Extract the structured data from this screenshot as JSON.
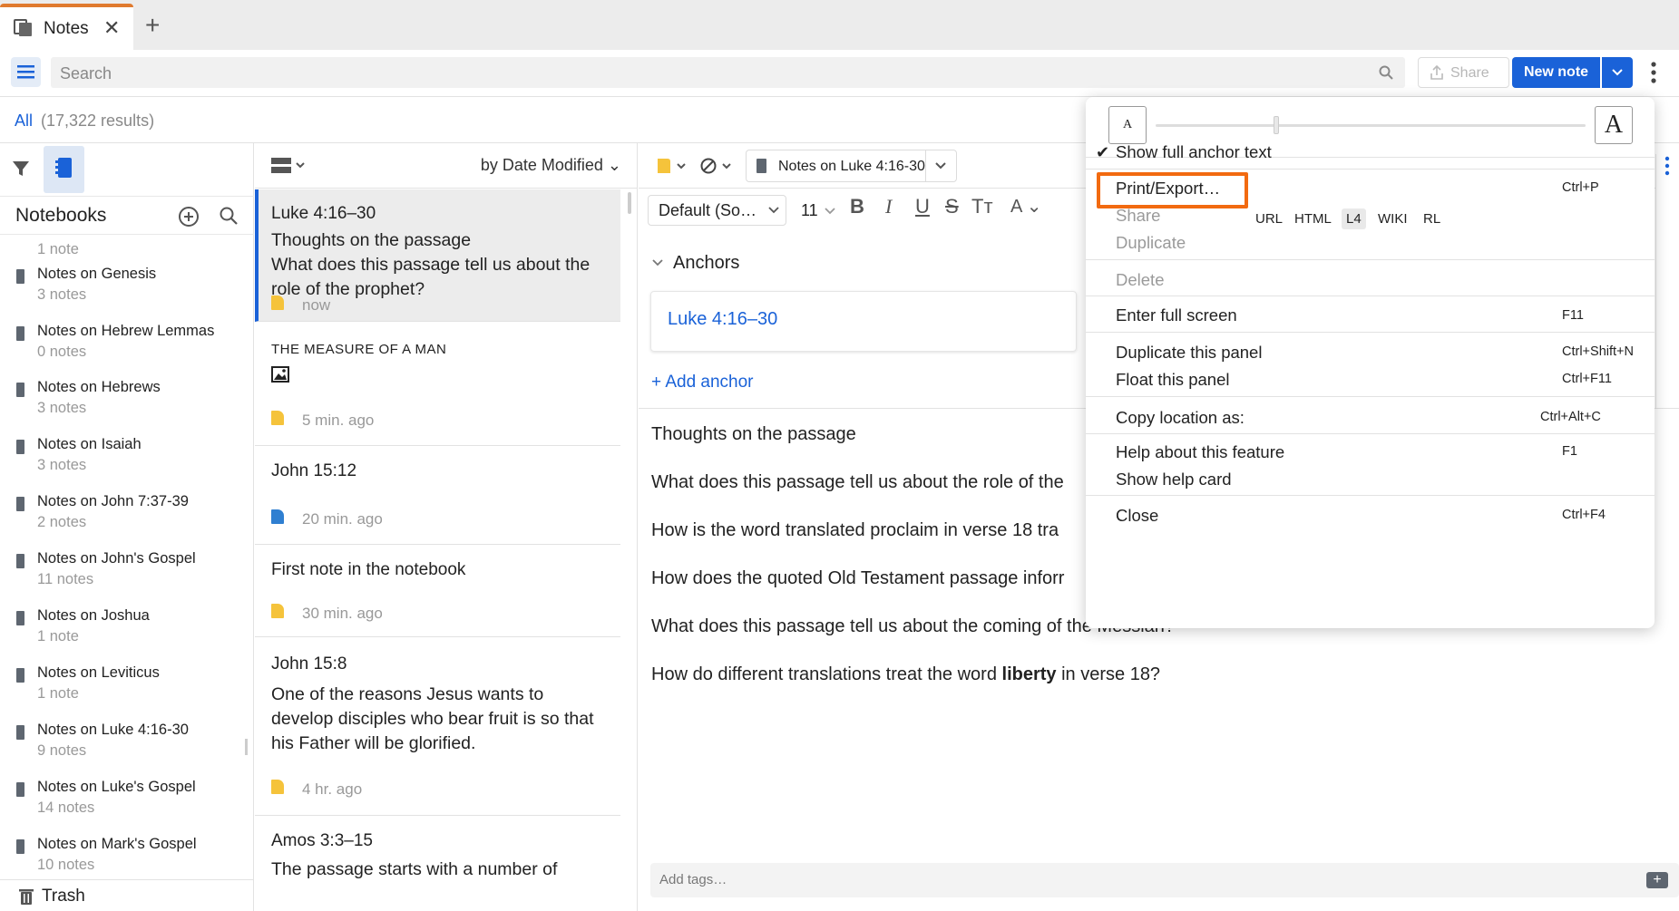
{
  "tab": {
    "label": "Notes"
  },
  "search": {
    "placeholder": "Search"
  },
  "toolbar": {
    "share_label": "Share",
    "new_note_label": "New note"
  },
  "results": {
    "scope": "All",
    "count": "(17,322 results)"
  },
  "notebooks": {
    "title": "Notebooks",
    "items": [
      {
        "name": "",
        "count": "1 note"
      },
      {
        "name": "Notes on Genesis",
        "count": "3 notes"
      },
      {
        "name": "Notes on Hebrew Lemmas",
        "count": "0 notes"
      },
      {
        "name": "Notes on Hebrews",
        "count": "3 notes"
      },
      {
        "name": "Notes on Isaiah",
        "count": "3 notes"
      },
      {
        "name": "Notes on John 7:37-39",
        "count": "2 notes"
      },
      {
        "name": "Notes on John's Gospel",
        "count": "11 notes"
      },
      {
        "name": "Notes on Joshua",
        "count": "1 note"
      },
      {
        "name": "Notes on Leviticus",
        "count": "1 note"
      },
      {
        "name": "Notes on Luke 4:16-30",
        "count": "9 notes"
      },
      {
        "name": "Notes on Luke's Gospel",
        "count": "14 notes"
      },
      {
        "name": "Notes on Mark's Gospel",
        "count": "10 notes"
      }
    ],
    "trash_label": "Trash"
  },
  "notelist": {
    "sort_label": "by Date Modified",
    "notes": [
      {
        "title": "Luke 4:16–30",
        "body": "Thoughts on the passage\nWhat does this passage tell us about the role of the prophet?",
        "time": "now",
        "tag_color": "#f5c33b"
      },
      {
        "title": "THE MEASURE OF A MAN",
        "body": "",
        "time": "5 min. ago",
        "tag_color": "#f5c33b"
      },
      {
        "title": "John 15:12",
        "body": "",
        "time": "20 min. ago",
        "tag_color": "#2f7fd1"
      },
      {
        "title": "First note in the notebook",
        "body": "",
        "time": "30 min. ago",
        "tag_color": "#f5c33b"
      },
      {
        "title": "John 15:8",
        "body": "One of the reasons Jesus wants to develop disciples who bear fruit is so that his Father will be glorified.",
        "time": "4 hr. ago",
        "tag_color": "#f5c33b"
      },
      {
        "title": "Amos 3:3–15",
        "body": "The passage starts with a number of",
        "time": "",
        "tag_color": "#f5c33b"
      }
    ]
  },
  "editor": {
    "notebook_label": "Notes on Luke 4:16-30",
    "font_label": "Default (So…",
    "size_label": "11",
    "anchors_heading": "Anchors",
    "anchor_ref": "Luke 4:16–30",
    "add_anchor": "+ Add anchor",
    "paragraphs": [
      "Thoughts on the passage",
      "What does this passage tell us about the role of the",
      "How is the word translated proclaim in verse 18 tra",
      "How does the quoted Old Testament passage inforr",
      "What does this passage tell us about the coming of the Messiah?"
    ],
    "para_last_pre": "How do different translations treat the word ",
    "para_last_bold": "liberty",
    "para_last_post": " in verse 18?",
    "tags_placeholder": "Add tags…"
  },
  "menu": {
    "show_full_anchor": "Show full anchor text",
    "print_export": "Print/Export…",
    "print_shortcut": "Ctrl+P",
    "share": "Share",
    "duplicate": "Duplicate",
    "delete": "Delete",
    "full_screen": "Enter full screen",
    "full_screen_shortcut": "F11",
    "dup_panel": "Duplicate this panel",
    "dup_panel_shortcut": "Ctrl+Shift+N",
    "float_panel": "Float this panel",
    "float_panel_shortcut": "Ctrl+F11",
    "copy_location": "Copy location as:",
    "formats": [
      "URL",
      "HTML",
      "L4",
      "WIKI",
      "RL"
    ],
    "copy_shortcut": "Ctrl+Alt+C",
    "help": "Help about this feature",
    "help_shortcut": "F1",
    "help_card": "Show help card",
    "close": "Close",
    "close_shortcut": "Ctrl+F4",
    "font_small": "A",
    "font_large": "A"
  },
  "colors": {
    "accent": "#1a62d8",
    "tab_accent": "#e07a2e",
    "highlight": "#f26a10"
  }
}
